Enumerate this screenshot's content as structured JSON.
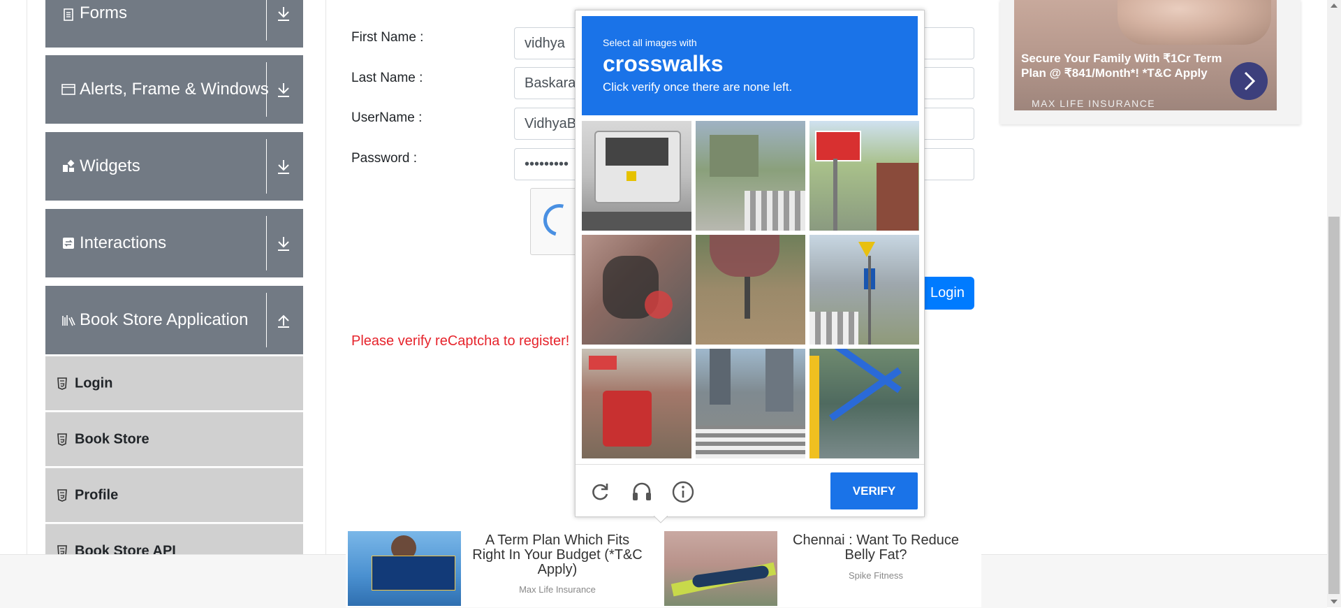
{
  "sidebar": {
    "groups": [
      {
        "label": "Forms",
        "icon": "document-icon",
        "arrow": "download-icon"
      },
      {
        "label": "Alerts, Frame & Windows",
        "icon": "window-icon",
        "arrow": "download-icon"
      },
      {
        "label": "Widgets",
        "icon": "widgets-icon",
        "arrow": "download-icon"
      },
      {
        "label": "Interactions",
        "icon": "interactions-icon",
        "arrow": "download-icon"
      },
      {
        "label": "Book Store Application",
        "icon": "books-icon",
        "arrow": "upload-icon"
      }
    ],
    "items": [
      {
        "label": "Login",
        "icon": "html5-icon"
      },
      {
        "label": "Book Store",
        "icon": "html5-icon"
      },
      {
        "label": "Profile",
        "icon": "html5-icon"
      },
      {
        "label": "Book Store API",
        "icon": "html5-icon"
      }
    ]
  },
  "form": {
    "first_name_label": "First Name :",
    "first_name_value": "vidhya",
    "last_name_label": "Last Name :",
    "last_name_value": "Baskaran",
    "username_label": "UserName :",
    "username_value": "VidhyaB",
    "password_label": "Password :",
    "password_value": "•••••••••",
    "login_button": "Login",
    "error": "Please verify reCaptcha to register!"
  },
  "captcha": {
    "instruction": "Select all images with",
    "target": "crosswalks",
    "subtitle": "Click verify once there are none left.",
    "verify_button": "VERIFY",
    "icons": [
      "reload-icon",
      "audio-icon",
      "info-icon"
    ]
  },
  "ad_right": {
    "text": "Secure Your Family With ₹1Cr Term Plan @ ₹841/Month*! *T&C Apply",
    "brand": "MAX LIFE INSURANCE"
  },
  "bottom_ads": [
    {
      "title": "A Term Plan Which Fits Right In Your Budget (*T&C Apply)",
      "source": "Max Life Insurance"
    },
    {
      "title": "Chennai : Want To Reduce Belly Fat?",
      "source": "Spike Fitness"
    }
  ],
  "colors": {
    "sidebar_group": "#727a84",
    "sidebar_item": "#d0d0d0",
    "captcha_blue": "#1a73e8",
    "error": "#e6242c",
    "primary": "#007bff"
  }
}
